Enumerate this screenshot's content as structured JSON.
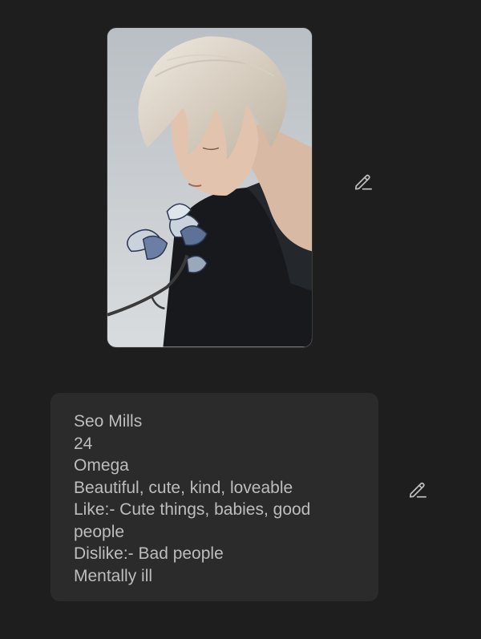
{
  "profile": {
    "image_icon": "character-portrait-image",
    "edit_icon": "pencil-edit-icon",
    "bio_lines": [
      "Seo Mills",
      "24",
      "Omega",
      "Beautiful, cute, kind, loveable",
      "Like:- Cute things, babies, good people",
      "Dislike:- Bad people",
      "Mentally ill"
    ]
  },
  "colors": {
    "background": "#1e1e1e",
    "card": "#2b2b2b",
    "text": "#bdbdbd",
    "icon": "#bdbdbd"
  }
}
